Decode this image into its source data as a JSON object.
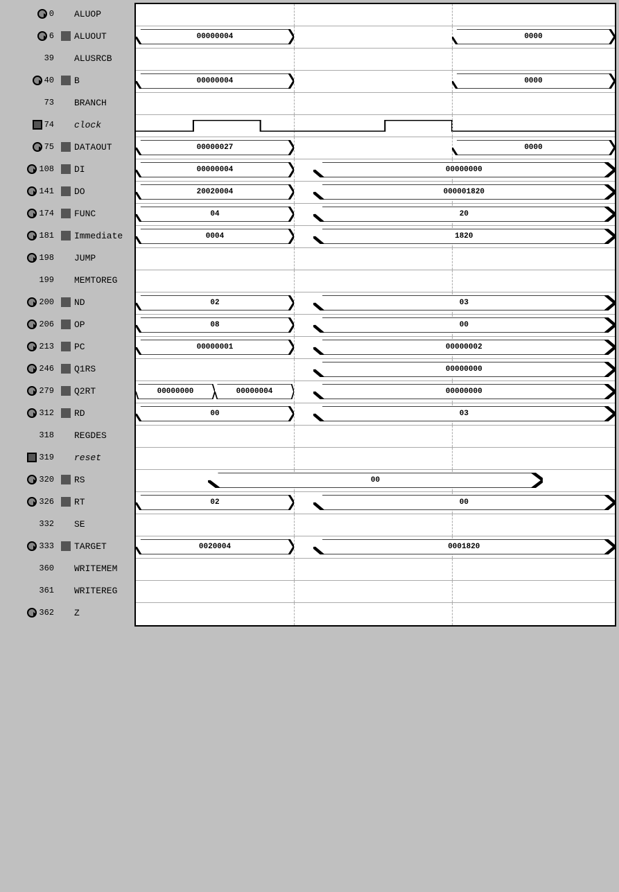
{
  "rows": [
    {
      "time": "0",
      "hasIcon": true,
      "iconType": "circle",
      "signal": "ALUOP",
      "hasSignalIcon": false,
      "waveType": "empty"
    },
    {
      "time": "6",
      "hasIcon": true,
      "iconType": "circle",
      "signal": "ALUOUT",
      "hasSignalIcon": true,
      "waveType": "bus",
      "segments": [
        {
          "label": "00000004",
          "left": 0,
          "width": 0.33
        },
        {
          "label": "0000",
          "left": 0.66,
          "width": 0.34,
          "partial": true
        }
      ]
    },
    {
      "time": "39",
      "hasIcon": false,
      "iconType": "",
      "signal": "ALUSRCB",
      "hasSignalIcon": false,
      "waveType": "empty"
    },
    {
      "time": "40",
      "hasIcon": true,
      "iconType": "circle",
      "signal": "B",
      "hasSignalIcon": true,
      "waveType": "bus",
      "segments": [
        {
          "label": "00000004",
          "left": 0,
          "width": 0.33
        },
        {
          "label": "0000",
          "left": 0.66,
          "width": 0.34,
          "partial": true
        }
      ]
    },
    {
      "time": "73",
      "hasIcon": false,
      "iconType": "",
      "signal": "BRANCH",
      "hasSignalIcon": false,
      "waveType": "empty"
    },
    {
      "time": "74",
      "hasIcon": true,
      "iconType": "square",
      "signal": "clock",
      "hasSignalIcon": false,
      "waveType": "clock"
    },
    {
      "time": "75",
      "hasIcon": true,
      "iconType": "circle",
      "signal": "DATAOUT",
      "hasSignalIcon": true,
      "waveType": "bus",
      "segments": [
        {
          "label": "00000027",
          "left": 0,
          "width": 0.33
        },
        {
          "label": "0000",
          "left": 0.66,
          "width": 0.34,
          "partial": true
        }
      ]
    },
    {
      "time": "108",
      "hasIcon": true,
      "iconType": "circle",
      "signal": "DI",
      "hasSignalIcon": true,
      "waveType": "bus",
      "segments": [
        {
          "label": "00000004",
          "left": 0,
          "width": 0.33
        },
        {
          "label": "00000000",
          "left": 0.37,
          "width": 0.63
        }
      ]
    },
    {
      "time": "141",
      "hasIcon": true,
      "iconType": "circle",
      "signal": "DO",
      "hasSignalIcon": true,
      "waveType": "bus",
      "segments": [
        {
          "label": "20020004",
          "left": 0,
          "width": 0.33
        },
        {
          "label": "000001820",
          "left": 0.37,
          "width": 0.63
        }
      ]
    },
    {
      "time": "174",
      "hasIcon": true,
      "iconType": "circle",
      "signal": "FUNC",
      "hasSignalIcon": true,
      "waveType": "bus",
      "segments": [
        {
          "label": "04",
          "left": 0,
          "width": 0.33
        },
        {
          "label": "20",
          "left": 0.37,
          "width": 0.63
        }
      ]
    },
    {
      "time": "181",
      "hasIcon": true,
      "iconType": "circle",
      "signal": "Immediate",
      "hasSignalIcon": true,
      "waveType": "bus",
      "segments": [
        {
          "label": "0004",
          "left": 0,
          "width": 0.33
        },
        {
          "label": "1820",
          "left": 0.37,
          "width": 0.63
        }
      ]
    },
    {
      "time": "198",
      "hasIcon": true,
      "iconType": "circle",
      "signal": "JUMP",
      "hasSignalIcon": false,
      "waveType": "empty"
    },
    {
      "time": "199",
      "hasIcon": false,
      "iconType": "",
      "signal": "MEMTOREG",
      "hasSignalIcon": false,
      "waveType": "empty"
    },
    {
      "time": "200",
      "hasIcon": true,
      "iconType": "circle",
      "signal": "ND",
      "hasSignalIcon": true,
      "waveType": "bus",
      "segments": [
        {
          "label": "02",
          "left": 0,
          "width": 0.33
        },
        {
          "label": "03",
          "left": 0.37,
          "width": 0.63
        }
      ]
    },
    {
      "time": "206",
      "hasIcon": true,
      "iconType": "circle",
      "signal": "OP",
      "hasSignalIcon": true,
      "waveType": "bus",
      "segments": [
        {
          "label": "08",
          "left": 0,
          "width": 0.33
        },
        {
          "label": "00",
          "left": 0.37,
          "width": 0.63
        }
      ]
    },
    {
      "time": "213",
      "hasIcon": true,
      "iconType": "circle",
      "signal": "PC",
      "hasSignalIcon": true,
      "waveType": "bus",
      "segments": [
        {
          "label": "00000001",
          "left": 0,
          "width": 0.33
        },
        {
          "label": "00000002",
          "left": 0.37,
          "width": 0.63
        }
      ]
    },
    {
      "time": "246",
      "hasIcon": true,
      "iconType": "circle",
      "signal": "Q1RS",
      "hasSignalIcon": true,
      "waveType": "bus",
      "segments": [
        {
          "label": "00000000",
          "left": 0.37,
          "width": 0.63
        }
      ]
    },
    {
      "time": "279",
      "hasIcon": true,
      "iconType": "circle",
      "signal": "Q2RT",
      "hasSignalIcon": true,
      "waveType": "bus",
      "segments": [
        {
          "label": "00000000",
          "left": 0,
          "width": 0.165
        },
        {
          "label": "00000004",
          "left": 0.165,
          "width": 0.165
        },
        {
          "label": "00000000",
          "left": 0.37,
          "width": 0.63
        }
      ]
    },
    {
      "time": "312",
      "hasIcon": true,
      "iconType": "circle",
      "signal": "RD",
      "hasSignalIcon": true,
      "waveType": "bus",
      "segments": [
        {
          "label": "00",
          "left": 0,
          "width": 0.33
        },
        {
          "label": "03",
          "left": 0.37,
          "width": 0.63
        }
      ]
    },
    {
      "time": "318",
      "hasIcon": false,
      "iconType": "",
      "signal": "REGDES",
      "hasSignalIcon": false,
      "waveType": "empty"
    },
    {
      "time": "319",
      "hasIcon": true,
      "iconType": "square",
      "signal": "reset",
      "hasSignalIcon": false,
      "waveType": "empty"
    },
    {
      "time": "320",
      "hasIcon": true,
      "iconType": "circle",
      "signal": "RS",
      "hasSignalIcon": true,
      "waveType": "bus",
      "segments": [
        {
          "label": "00",
          "left": 0.15,
          "width": 0.7,
          "center": true
        }
      ]
    },
    {
      "time": "326",
      "hasIcon": true,
      "iconType": "circle",
      "signal": "RT",
      "hasSignalIcon": true,
      "waveType": "bus",
      "segments": [
        {
          "label": "02",
          "left": 0,
          "width": 0.33
        },
        {
          "label": "00",
          "left": 0.37,
          "width": 0.63
        }
      ]
    },
    {
      "time": "332",
      "hasIcon": false,
      "iconType": "",
      "signal": "SE",
      "hasSignalIcon": false,
      "waveType": "empty"
    },
    {
      "time": "333",
      "hasIcon": true,
      "iconType": "circle",
      "signal": "TARGET",
      "hasSignalIcon": true,
      "waveType": "bus",
      "segments": [
        {
          "label": "0020004",
          "left": 0,
          "width": 0.33
        },
        {
          "label": "0001820",
          "left": 0.37,
          "width": 0.63
        }
      ]
    },
    {
      "time": "360",
      "hasIcon": false,
      "iconType": "",
      "signal": "WRITEMEM",
      "hasSignalIcon": false,
      "waveType": "empty"
    },
    {
      "time": "361",
      "hasIcon": false,
      "iconType": "",
      "signal": "WRITEREG",
      "hasSignalIcon": false,
      "waveType": "empty"
    },
    {
      "time": "362",
      "hasIcon": true,
      "iconType": "circle",
      "signal": "Z",
      "hasSignalIcon": false,
      "waveType": "empty"
    }
  ]
}
